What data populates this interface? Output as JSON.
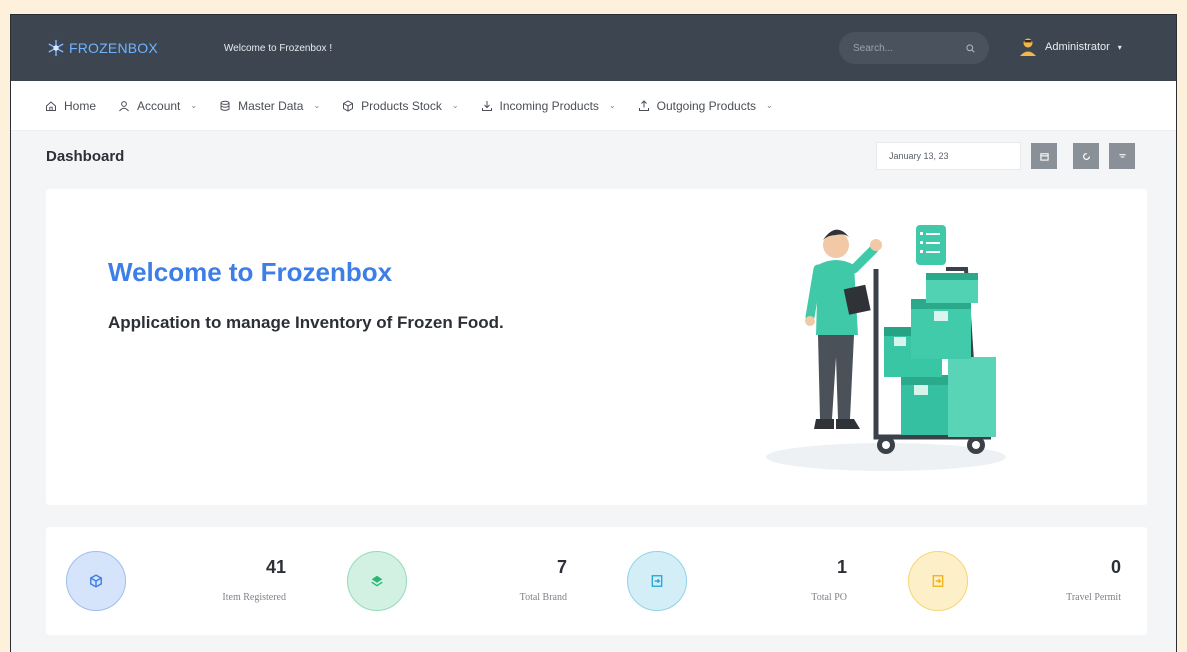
{
  "topbar": {
    "logo_text": "FROZENBOX",
    "welcome": "Welcome to Frozenbox !",
    "search_placeholder": "Search...",
    "user_name": "Administrator"
  },
  "nav": {
    "items": [
      {
        "label": "Home",
        "icon": "home-icon",
        "has_dropdown": false
      },
      {
        "label": "Account",
        "icon": "user-icon",
        "has_dropdown": true
      },
      {
        "label": "Master Data",
        "icon": "database-icon",
        "has_dropdown": true
      },
      {
        "label": "Products Stock",
        "icon": "box-icon",
        "has_dropdown": true
      },
      {
        "label": "Incoming Products",
        "icon": "download-icon",
        "has_dropdown": true
      },
      {
        "label": "Outgoing Products",
        "icon": "upload-icon",
        "has_dropdown": true
      }
    ]
  },
  "page": {
    "title": "Dashboard",
    "date": "January 13, 23"
  },
  "hero": {
    "title": "Welcome to Frozenbox",
    "subtitle": "Application to manage Inventory of Frozen Food."
  },
  "stats": [
    {
      "value": "41",
      "label": "Item Registered",
      "icon": "cube-icon",
      "color": "#3d7fe6",
      "bg": "#d6e4fb"
    },
    {
      "value": "7",
      "label": "Total Brand",
      "icon": "layers-icon",
      "color": "#2bb673",
      "bg": "#d3f1e2"
    },
    {
      "value": "1",
      "label": "Total PO",
      "icon": "login-icon",
      "color": "#27a9d6",
      "bg": "#d4eef8"
    },
    {
      "value": "0",
      "label": "Travel Permit",
      "icon": "logout-icon",
      "color": "#f2b21b",
      "bg": "#fdf0c9"
    }
  ],
  "colors": {
    "topbar": "#3d4650",
    "accent": "#3d7fe6"
  }
}
